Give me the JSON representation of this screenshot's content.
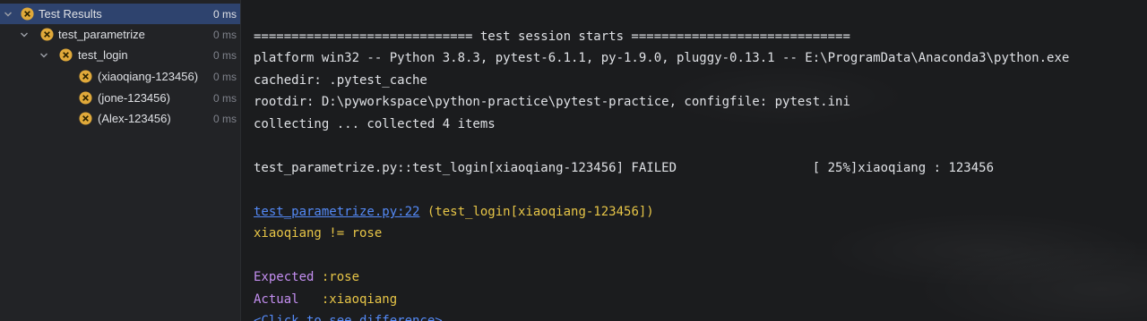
{
  "test_tree": {
    "root": {
      "label": "Test Results",
      "time": "0 ms"
    },
    "items": [
      {
        "label": "test_parametrize",
        "time": "0 ms"
      },
      {
        "label": "test_login",
        "time": "0 ms"
      },
      {
        "label": "(xiaoqiang-123456)",
        "time": "0 ms"
      },
      {
        "label": "(jone-123456)",
        "time": "0 ms"
      },
      {
        "label": "(Alex-123456)",
        "time": "0 ms"
      }
    ]
  },
  "console": {
    "session_header": "============================= test session starts =============================",
    "platform": "platform win32 -- Python 3.8.3, pytest-6.1.1, py-1.9.0, pluggy-0.13.1 -- E:\\ProgramData\\Anaconda3\\python.exe",
    "cachedir": "cachedir: .pytest_cache",
    "rootdir": "rootdir: D:\\pyworkspace\\python-practice\\pytest-practice, configfile: pytest.ini",
    "collecting": "collecting ... collected 4 items",
    "result_line": "test_parametrize.py::test_login[xiaoqiang-123456] FAILED                  [ 25%]xiaoqiang : 123456",
    "trace_link": "test_parametrize.py:22",
    "trace_rest": " (test_login[xiaoqiang-123456])",
    "assert_msg": "xiaoqiang != rose",
    "expected_key": "Expected ",
    "expected_val": ":rose",
    "actual_key": "Actual   ",
    "actual_val": ":xiaoqiang",
    "diff_link": "<Click to see difference>"
  },
  "colors": {
    "fail_icon": "#e0a93a",
    "selected_row": "#2e436e",
    "link": "#548af7",
    "output_yellow": "#e7c547",
    "label_purple": "#c38ef0"
  },
  "icons": {
    "expand": "chevron-down-icon",
    "status": "failed-x-circle-icon"
  }
}
